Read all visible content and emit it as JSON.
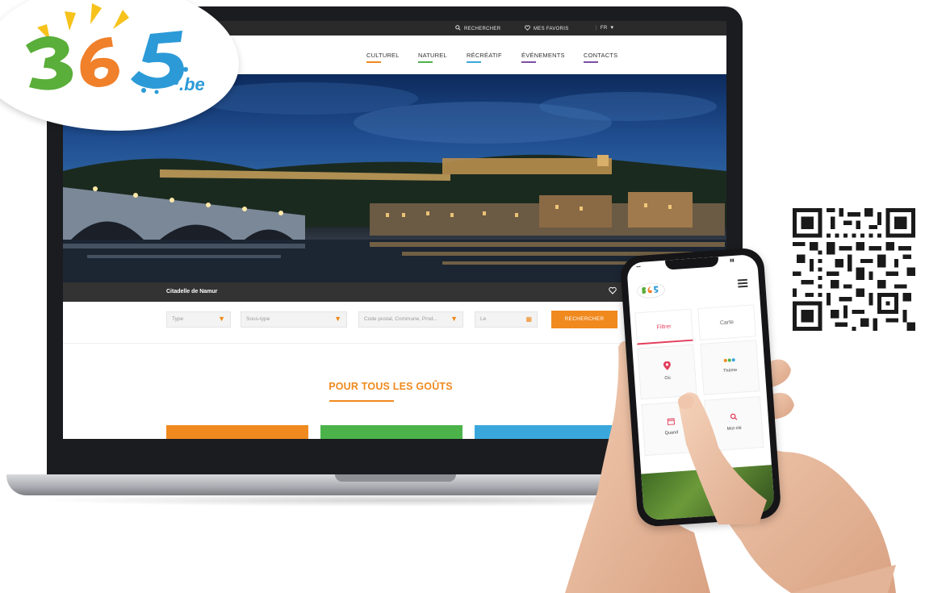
{
  "logo": {
    "number": "365",
    "tld": ".be"
  },
  "site": {
    "topbar": {
      "search_label": "RECHERCHER",
      "favorites_label": "MES FAVORIS",
      "language": "FR"
    },
    "nav": [
      {
        "label": "CULTUREL",
        "color": "#f08a1f"
      },
      {
        "label": "NATUREL",
        "color": "#4bb34a"
      },
      {
        "label": "RÉCRÉATIF",
        "color": "#3aa7dc"
      },
      {
        "label": "ÉVÉNEMENTS",
        "color": "#7b4ea3"
      },
      {
        "label": "CONTACTS",
        "color": "#7b4ea3"
      }
    ],
    "hero_caption": "Citadelle de Namur",
    "search": {
      "type_placeholder": "Type",
      "subtype_placeholder": "Sous-type",
      "location_placeholder": "Code postal, Commune, Prod...",
      "distance_placeholder": "Le",
      "button_label": "RECHERCHER"
    },
    "section_title": "POUR TOUS LES GOÛTS",
    "cards": [
      {
        "color": "#f08a1f"
      },
      {
        "color": "#4bb34a"
      },
      {
        "color": "#3aa7dc"
      }
    ]
  },
  "phone": {
    "logo_text": "365",
    "tabs": [
      {
        "label": "Filtrer"
      },
      {
        "label": "Carte"
      }
    ],
    "cells": [
      {
        "label": "Où",
        "icon": "location-pin-icon"
      },
      {
        "label": "Thème",
        "icon": "dots-icon"
      },
      {
        "label": "Quand",
        "icon": "calendar-icon"
      },
      {
        "label": "Mot-clé",
        "icon": "search-icon"
      }
    ]
  },
  "colors": {
    "orange": "#f08a1f",
    "green": "#4bb34a",
    "blue": "#3aa7dc",
    "purple": "#7b4ea3",
    "red_accent": "#e23d5a"
  }
}
